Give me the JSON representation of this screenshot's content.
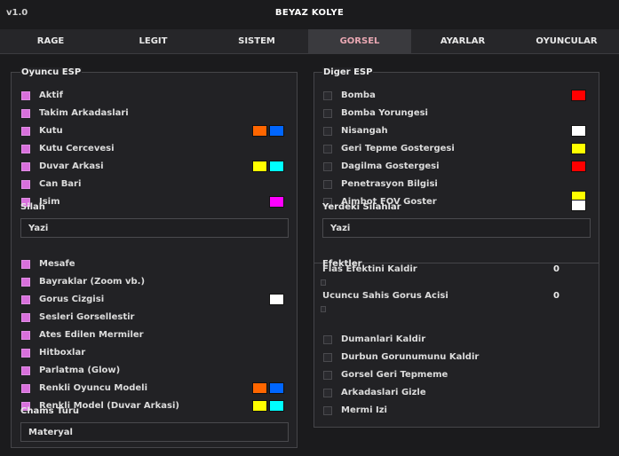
{
  "header": {
    "version": "v1.0",
    "title": "BEYAZ KOLYE"
  },
  "tabs": [
    "RAGE",
    "LEGIT",
    "SISTEM",
    "GORSEL",
    "AYARLAR",
    "OYUNCULAR"
  ],
  "active_tab": "GORSEL",
  "left": {
    "title": "Oyuncu ESP",
    "items1": [
      {
        "label": "Aktif",
        "checked": true,
        "colors": []
      },
      {
        "label": "Takim Arkadaslari",
        "checked": true,
        "colors": []
      },
      {
        "label": "Kutu",
        "checked": true,
        "colors": [
          "#ff6600",
          "#0066ff"
        ]
      },
      {
        "label": "Kutu Cercevesi",
        "checked": true,
        "colors": []
      },
      {
        "label": "Duvar Arkasi",
        "checked": true,
        "colors": [
          "#ffff00",
          "#00ffff"
        ]
      },
      {
        "label": "Can Bari",
        "checked": true,
        "colors": []
      },
      {
        "label": "Isim",
        "checked": true,
        "colors": [
          "#ff00ff"
        ]
      }
    ],
    "weapon_label": "Silah",
    "weapon_value": "Yazi",
    "items2": [
      {
        "label": "Mesafe",
        "checked": true,
        "colors": []
      },
      {
        "label": "Bayraklar (Zoom vb.)",
        "checked": true,
        "colors": []
      },
      {
        "label": "Gorus Cizgisi",
        "checked": true,
        "colors": [
          "#ffffff"
        ]
      },
      {
        "label": "Sesleri Gorsellestir",
        "checked": true,
        "colors": []
      },
      {
        "label": "Ates Edilen Mermiler",
        "checked": true,
        "colors": []
      },
      {
        "label": "Hitboxlar",
        "checked": true,
        "colors": []
      },
      {
        "label": "Parlatma (Glow)",
        "checked": true,
        "colors": []
      },
      {
        "label": "Renkli Oyuncu Modeli",
        "checked": true,
        "colors": [
          "#ff6600",
          "#0066ff"
        ]
      },
      {
        "label": "Renkli Model (Duvar Arkasi)",
        "checked": true,
        "colors": [
          "#ffff00",
          "#00ffff"
        ]
      }
    ],
    "chams_label": "Chams Turu",
    "chams_value": "Materyal"
  },
  "right": {
    "title": "Diger ESP",
    "items1": [
      {
        "label": "Bomba",
        "checked": false,
        "colors": [
          "#ff0000"
        ]
      },
      {
        "label": "Bomba Yorungesi",
        "checked": false,
        "colors": []
      },
      {
        "label": "Nisangah",
        "checked": false,
        "colors": [
          "#ffffff"
        ]
      },
      {
        "label": "Geri Tepme Gostergesi",
        "checked": false,
        "colors": [
          "#ffff00"
        ]
      },
      {
        "label": "Dagilma Gostergesi",
        "checked": false,
        "colors": [
          "#ff0000"
        ]
      },
      {
        "label": "Penetrasyon Bilgisi",
        "checked": false,
        "colors": []
      },
      {
        "label": "Aimbot FOV Goster",
        "checked": false,
        "colors": [
          "#ffff00",
          "#ffffff"
        ]
      }
    ],
    "weapon_label": "Yerdeki Silahlar",
    "weapon_value": "Yazi",
    "effects_label": "Efektler",
    "sliders": [
      {
        "label": "Flas Efektini Kaldir",
        "value": "0"
      },
      {
        "label": "Ucuncu Sahis Gorus Acisi",
        "value": "0"
      }
    ],
    "items2": [
      {
        "label": "Dumanlari Kaldir",
        "checked": false,
        "colors": []
      },
      {
        "label": "Durbun Gorunumunu Kaldir",
        "checked": false,
        "colors": []
      },
      {
        "label": "Gorsel Geri Tepmeme",
        "checked": false,
        "colors": []
      },
      {
        "label": "Arkadaslari Gizle",
        "checked": false,
        "colors": []
      },
      {
        "label": "Mermi Izi",
        "checked": false,
        "colors": []
      }
    ]
  }
}
